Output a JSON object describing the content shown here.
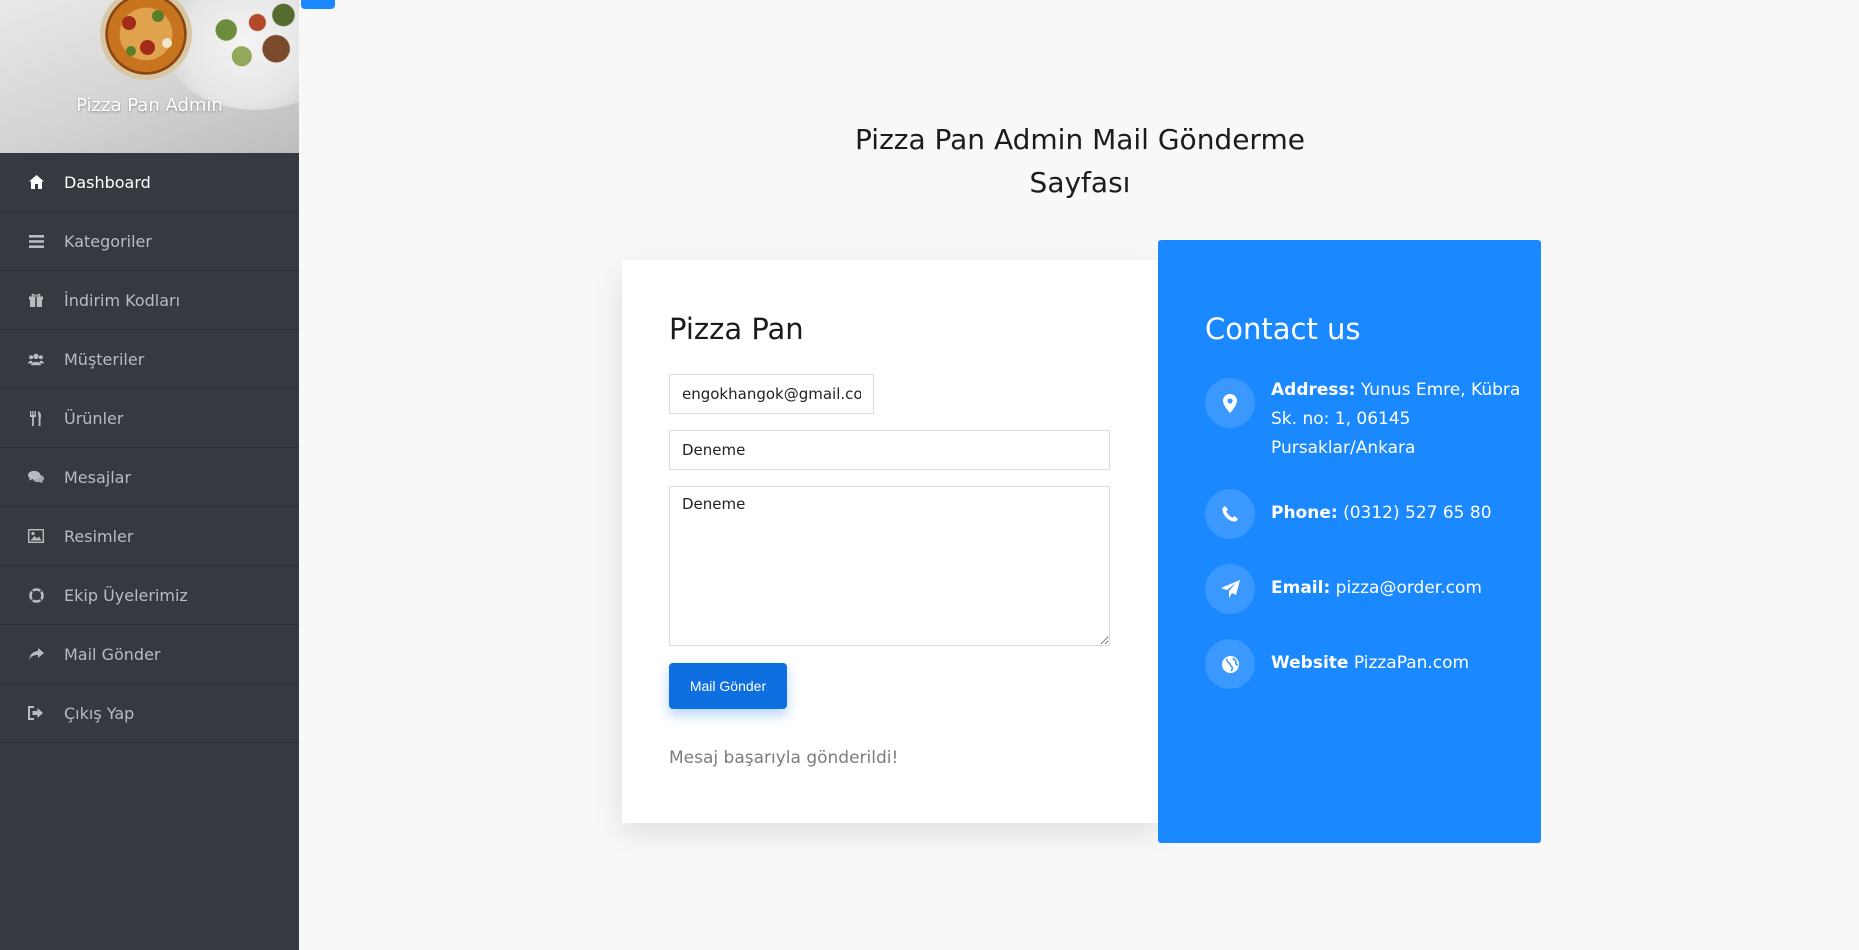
{
  "sidebar": {
    "brand": "Pizza Pan Admin",
    "items": [
      {
        "label": "Dashboard",
        "icon": "home-icon",
        "active": true
      },
      {
        "label": "Kategoriler",
        "icon": "list-icon",
        "active": false
      },
      {
        "label": "İndirim Kodları",
        "icon": "gift-icon",
        "active": false
      },
      {
        "label": "Müşteriler",
        "icon": "users-icon",
        "active": false
      },
      {
        "label": "Ürünler",
        "icon": "cutlery-icon",
        "active": false
      },
      {
        "label": "Mesajlar",
        "icon": "comments-icon",
        "active": false
      },
      {
        "label": "Resimler",
        "icon": "image-icon",
        "active": false
      },
      {
        "label": "Ekip Üyelerimiz",
        "icon": "life-ring-icon",
        "active": false
      },
      {
        "label": "Mail Gönder",
        "icon": "share-icon",
        "active": false
      },
      {
        "label": "Çıkış Yap",
        "icon": "sign-out-icon",
        "active": false
      }
    ]
  },
  "page": {
    "title_line1": "Pizza Pan Admin Mail Gönderme",
    "title_line2": "Sayfası"
  },
  "form": {
    "title": "Pizza Pan",
    "email_value": "engokhangok@gmail.com",
    "subject_value": "Deneme",
    "message_value": "Deneme",
    "submit_label": "Mail Gönder",
    "success_text": "Mesaj başarıyla gönderildi!"
  },
  "contact": {
    "title": "Contact us",
    "address_key": "Address:",
    "address_value": "Yunus Emre, Kübra Sk. no: 1, 06145 Pursaklar/Ankara",
    "phone_key": "Phone:",
    "phone_value": "(0312) 527 65 80",
    "email_key": "Email:",
    "email_value": "pizza@order.com",
    "website_key": "Website",
    "website_value": "PizzaPan.com"
  },
  "colors": {
    "sidebar_bg": "#343a40",
    "accent": "#1a88ff",
    "button": "#0d6fe0"
  }
}
